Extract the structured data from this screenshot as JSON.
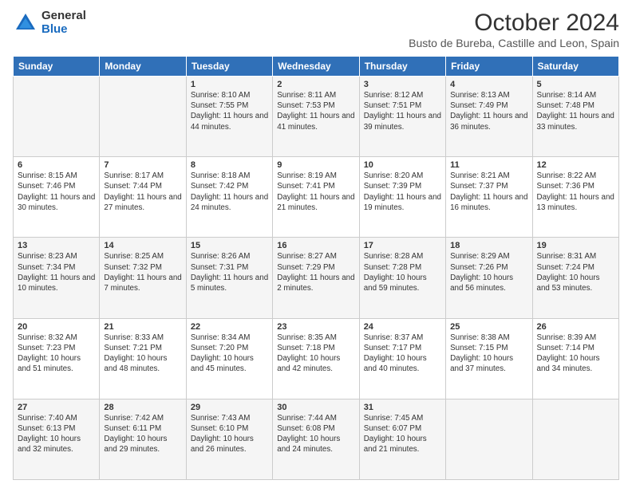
{
  "logo": {
    "general": "General",
    "blue": "Blue"
  },
  "title": "October 2024",
  "location": "Busto de Bureba, Castille and Leon, Spain",
  "days_of_week": [
    "Sunday",
    "Monday",
    "Tuesday",
    "Wednesday",
    "Thursday",
    "Friday",
    "Saturday"
  ],
  "weeks": [
    [
      {
        "day": "",
        "info": ""
      },
      {
        "day": "",
        "info": ""
      },
      {
        "day": "1",
        "info": "Sunrise: 8:10 AM\nSunset: 7:55 PM\nDaylight: 11 hours and 44 minutes."
      },
      {
        "day": "2",
        "info": "Sunrise: 8:11 AM\nSunset: 7:53 PM\nDaylight: 11 hours and 41 minutes."
      },
      {
        "day": "3",
        "info": "Sunrise: 8:12 AM\nSunset: 7:51 PM\nDaylight: 11 hours and 39 minutes."
      },
      {
        "day": "4",
        "info": "Sunrise: 8:13 AM\nSunset: 7:49 PM\nDaylight: 11 hours and 36 minutes."
      },
      {
        "day": "5",
        "info": "Sunrise: 8:14 AM\nSunset: 7:48 PM\nDaylight: 11 hours and 33 minutes."
      }
    ],
    [
      {
        "day": "6",
        "info": "Sunrise: 8:15 AM\nSunset: 7:46 PM\nDaylight: 11 hours and 30 minutes."
      },
      {
        "day": "7",
        "info": "Sunrise: 8:17 AM\nSunset: 7:44 PM\nDaylight: 11 hours and 27 minutes."
      },
      {
        "day": "8",
        "info": "Sunrise: 8:18 AM\nSunset: 7:42 PM\nDaylight: 11 hours and 24 minutes."
      },
      {
        "day": "9",
        "info": "Sunrise: 8:19 AM\nSunset: 7:41 PM\nDaylight: 11 hours and 21 minutes."
      },
      {
        "day": "10",
        "info": "Sunrise: 8:20 AM\nSunset: 7:39 PM\nDaylight: 11 hours and 19 minutes."
      },
      {
        "day": "11",
        "info": "Sunrise: 8:21 AM\nSunset: 7:37 PM\nDaylight: 11 hours and 16 minutes."
      },
      {
        "day": "12",
        "info": "Sunrise: 8:22 AM\nSunset: 7:36 PM\nDaylight: 11 hours and 13 minutes."
      }
    ],
    [
      {
        "day": "13",
        "info": "Sunrise: 8:23 AM\nSunset: 7:34 PM\nDaylight: 11 hours and 10 minutes."
      },
      {
        "day": "14",
        "info": "Sunrise: 8:25 AM\nSunset: 7:32 PM\nDaylight: 11 hours and 7 minutes."
      },
      {
        "day": "15",
        "info": "Sunrise: 8:26 AM\nSunset: 7:31 PM\nDaylight: 11 hours and 5 minutes."
      },
      {
        "day": "16",
        "info": "Sunrise: 8:27 AM\nSunset: 7:29 PM\nDaylight: 11 hours and 2 minutes."
      },
      {
        "day": "17",
        "info": "Sunrise: 8:28 AM\nSunset: 7:28 PM\nDaylight: 10 hours and 59 minutes."
      },
      {
        "day": "18",
        "info": "Sunrise: 8:29 AM\nSunset: 7:26 PM\nDaylight: 10 hours and 56 minutes."
      },
      {
        "day": "19",
        "info": "Sunrise: 8:31 AM\nSunset: 7:24 PM\nDaylight: 10 hours and 53 minutes."
      }
    ],
    [
      {
        "day": "20",
        "info": "Sunrise: 8:32 AM\nSunset: 7:23 PM\nDaylight: 10 hours and 51 minutes."
      },
      {
        "day": "21",
        "info": "Sunrise: 8:33 AM\nSunset: 7:21 PM\nDaylight: 10 hours and 48 minutes."
      },
      {
        "day": "22",
        "info": "Sunrise: 8:34 AM\nSunset: 7:20 PM\nDaylight: 10 hours and 45 minutes."
      },
      {
        "day": "23",
        "info": "Sunrise: 8:35 AM\nSunset: 7:18 PM\nDaylight: 10 hours and 42 minutes."
      },
      {
        "day": "24",
        "info": "Sunrise: 8:37 AM\nSunset: 7:17 PM\nDaylight: 10 hours and 40 minutes."
      },
      {
        "day": "25",
        "info": "Sunrise: 8:38 AM\nSunset: 7:15 PM\nDaylight: 10 hours and 37 minutes."
      },
      {
        "day": "26",
        "info": "Sunrise: 8:39 AM\nSunset: 7:14 PM\nDaylight: 10 hours and 34 minutes."
      }
    ],
    [
      {
        "day": "27",
        "info": "Sunrise: 7:40 AM\nSunset: 6:13 PM\nDaylight: 10 hours and 32 minutes."
      },
      {
        "day": "28",
        "info": "Sunrise: 7:42 AM\nSunset: 6:11 PM\nDaylight: 10 hours and 29 minutes."
      },
      {
        "day": "29",
        "info": "Sunrise: 7:43 AM\nSunset: 6:10 PM\nDaylight: 10 hours and 26 minutes."
      },
      {
        "day": "30",
        "info": "Sunrise: 7:44 AM\nSunset: 6:08 PM\nDaylight: 10 hours and 24 minutes."
      },
      {
        "day": "31",
        "info": "Sunrise: 7:45 AM\nSunset: 6:07 PM\nDaylight: 10 hours and 21 minutes."
      },
      {
        "day": "",
        "info": ""
      },
      {
        "day": "",
        "info": ""
      }
    ]
  ]
}
